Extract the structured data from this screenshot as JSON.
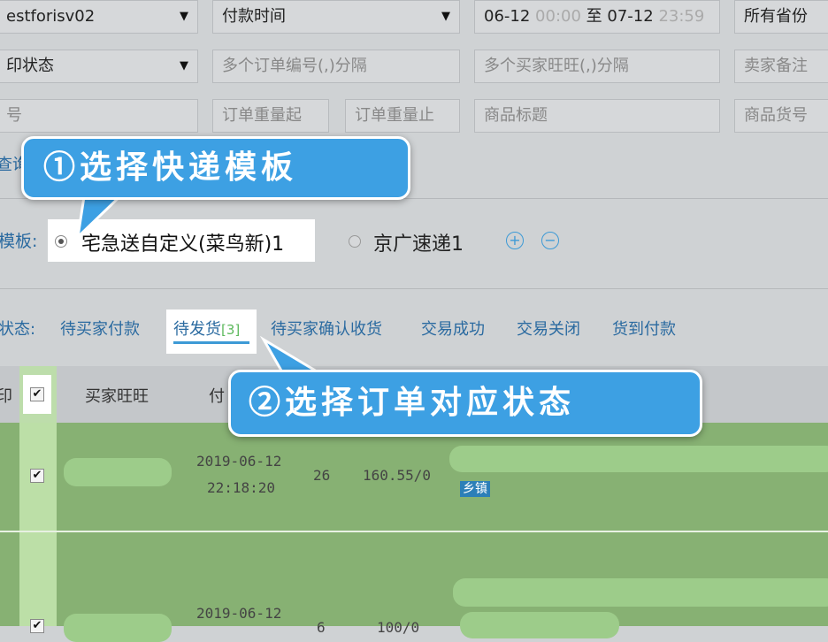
{
  "filters": {
    "account": "estforisv02",
    "time_type": "付款时间",
    "date_start": "06-12",
    "time_start": "00:00",
    "date_sep": "至",
    "date_end": "07-12",
    "time_end": "23:59",
    "province": "所有省份",
    "print_status": "印状态",
    "order_nos_placeholder": "多个订单编号(,)分隔",
    "buyer_ids_placeholder": "多个买家旺旺(,)分隔",
    "seller_note_placeholder": "卖家备注",
    "tracking_no_placeholder": "号",
    "weight_from_placeholder": "订单重量起",
    "weight_to_placeholder": "订单重量止",
    "product_title_placeholder": "商品标题",
    "product_sku_placeholder": "商品货号",
    "query_button": "查询"
  },
  "template": {
    "label": "模板:",
    "options": [
      {
        "label": "宅急送自定义(菜鸟新)1",
        "selected": true
      },
      {
        "label": "京广速递1",
        "selected": false
      }
    ]
  },
  "status": {
    "label": "状态:",
    "tabs": [
      {
        "label": "待买家付款"
      },
      {
        "label": "待发货",
        "count": "[3]",
        "active": true
      },
      {
        "label": "待买家确认收货"
      },
      {
        "label": "交易成功"
      },
      {
        "label": "交易关闭"
      },
      {
        "label": "货到付款"
      }
    ]
  },
  "table": {
    "header_print": "印",
    "header_buyer": "买家旺旺",
    "header_pay": "付",
    "rows": [
      {
        "date": "2019-06-12",
        "time": "22:18:20",
        "qty": "26",
        "amount": "160.55/0",
        "tag": "乡镇",
        "checked": true
      },
      {
        "date": "2019-06-12",
        "qty": "6",
        "amount": "100/0",
        "checked": true
      }
    ]
  },
  "callouts": {
    "step1": "①选择快递模板",
    "step2": "②选择订单对应状态"
  },
  "colors": {
    "callout_bg": "#3da0e3",
    "row_green": "#87b173",
    "link": "#2a6aa0",
    "active_underline": "#3d9ad6"
  }
}
